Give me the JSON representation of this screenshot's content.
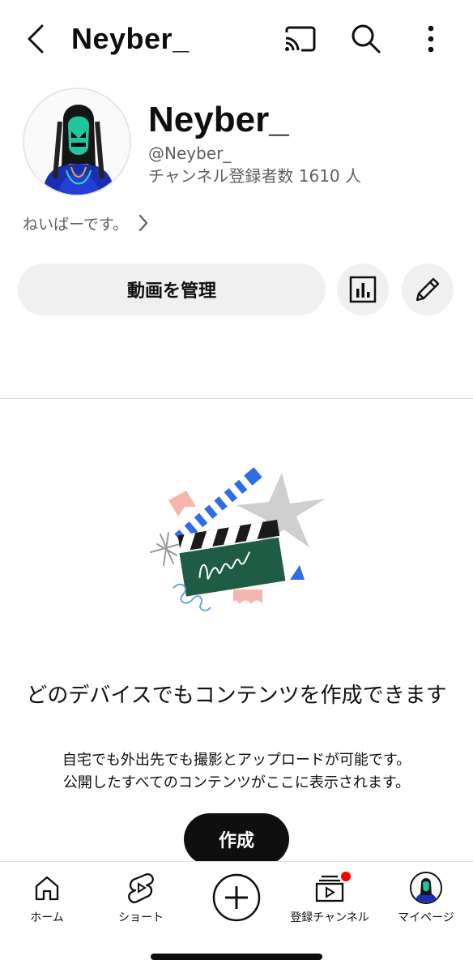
{
  "header": {
    "title": "Neyber_",
    "icons": [
      "back-arrow-icon",
      "cast-icon",
      "search-icon",
      "more-vertical-icon"
    ]
  },
  "channel": {
    "name": "Neyber_",
    "handle": "@Neyber_",
    "subscribers": "チャンネル登録者数 1610 人",
    "description": "ねいばーです。"
  },
  "actions": {
    "manage_label": "動画を管理",
    "icons": [
      "analytics-icon",
      "edit-pencil-icon"
    ]
  },
  "empty_state": {
    "title": "どのデバイスでもコンテンツを作成できます",
    "subtitle_line1": "自宅でも外出先でも撮影とアップロードが可能です。",
    "subtitle_line2": "公開したすべてのコンテンツがここに表示されます。",
    "create_label": "作成"
  },
  "bottom_nav": {
    "home": "ホーム",
    "shorts": "ショート",
    "subscriptions": "登録チャンネル",
    "mypage": "マイページ",
    "notification_color": "#ff0000"
  },
  "colors": {
    "text": "#0f0f0f",
    "secondary_text": "#606060",
    "button_bg": "#f0f0f0",
    "clapper_green": "#1e5c45",
    "clapper_blue": "#2f6de8",
    "accent_pink": "#f7b6ad"
  }
}
